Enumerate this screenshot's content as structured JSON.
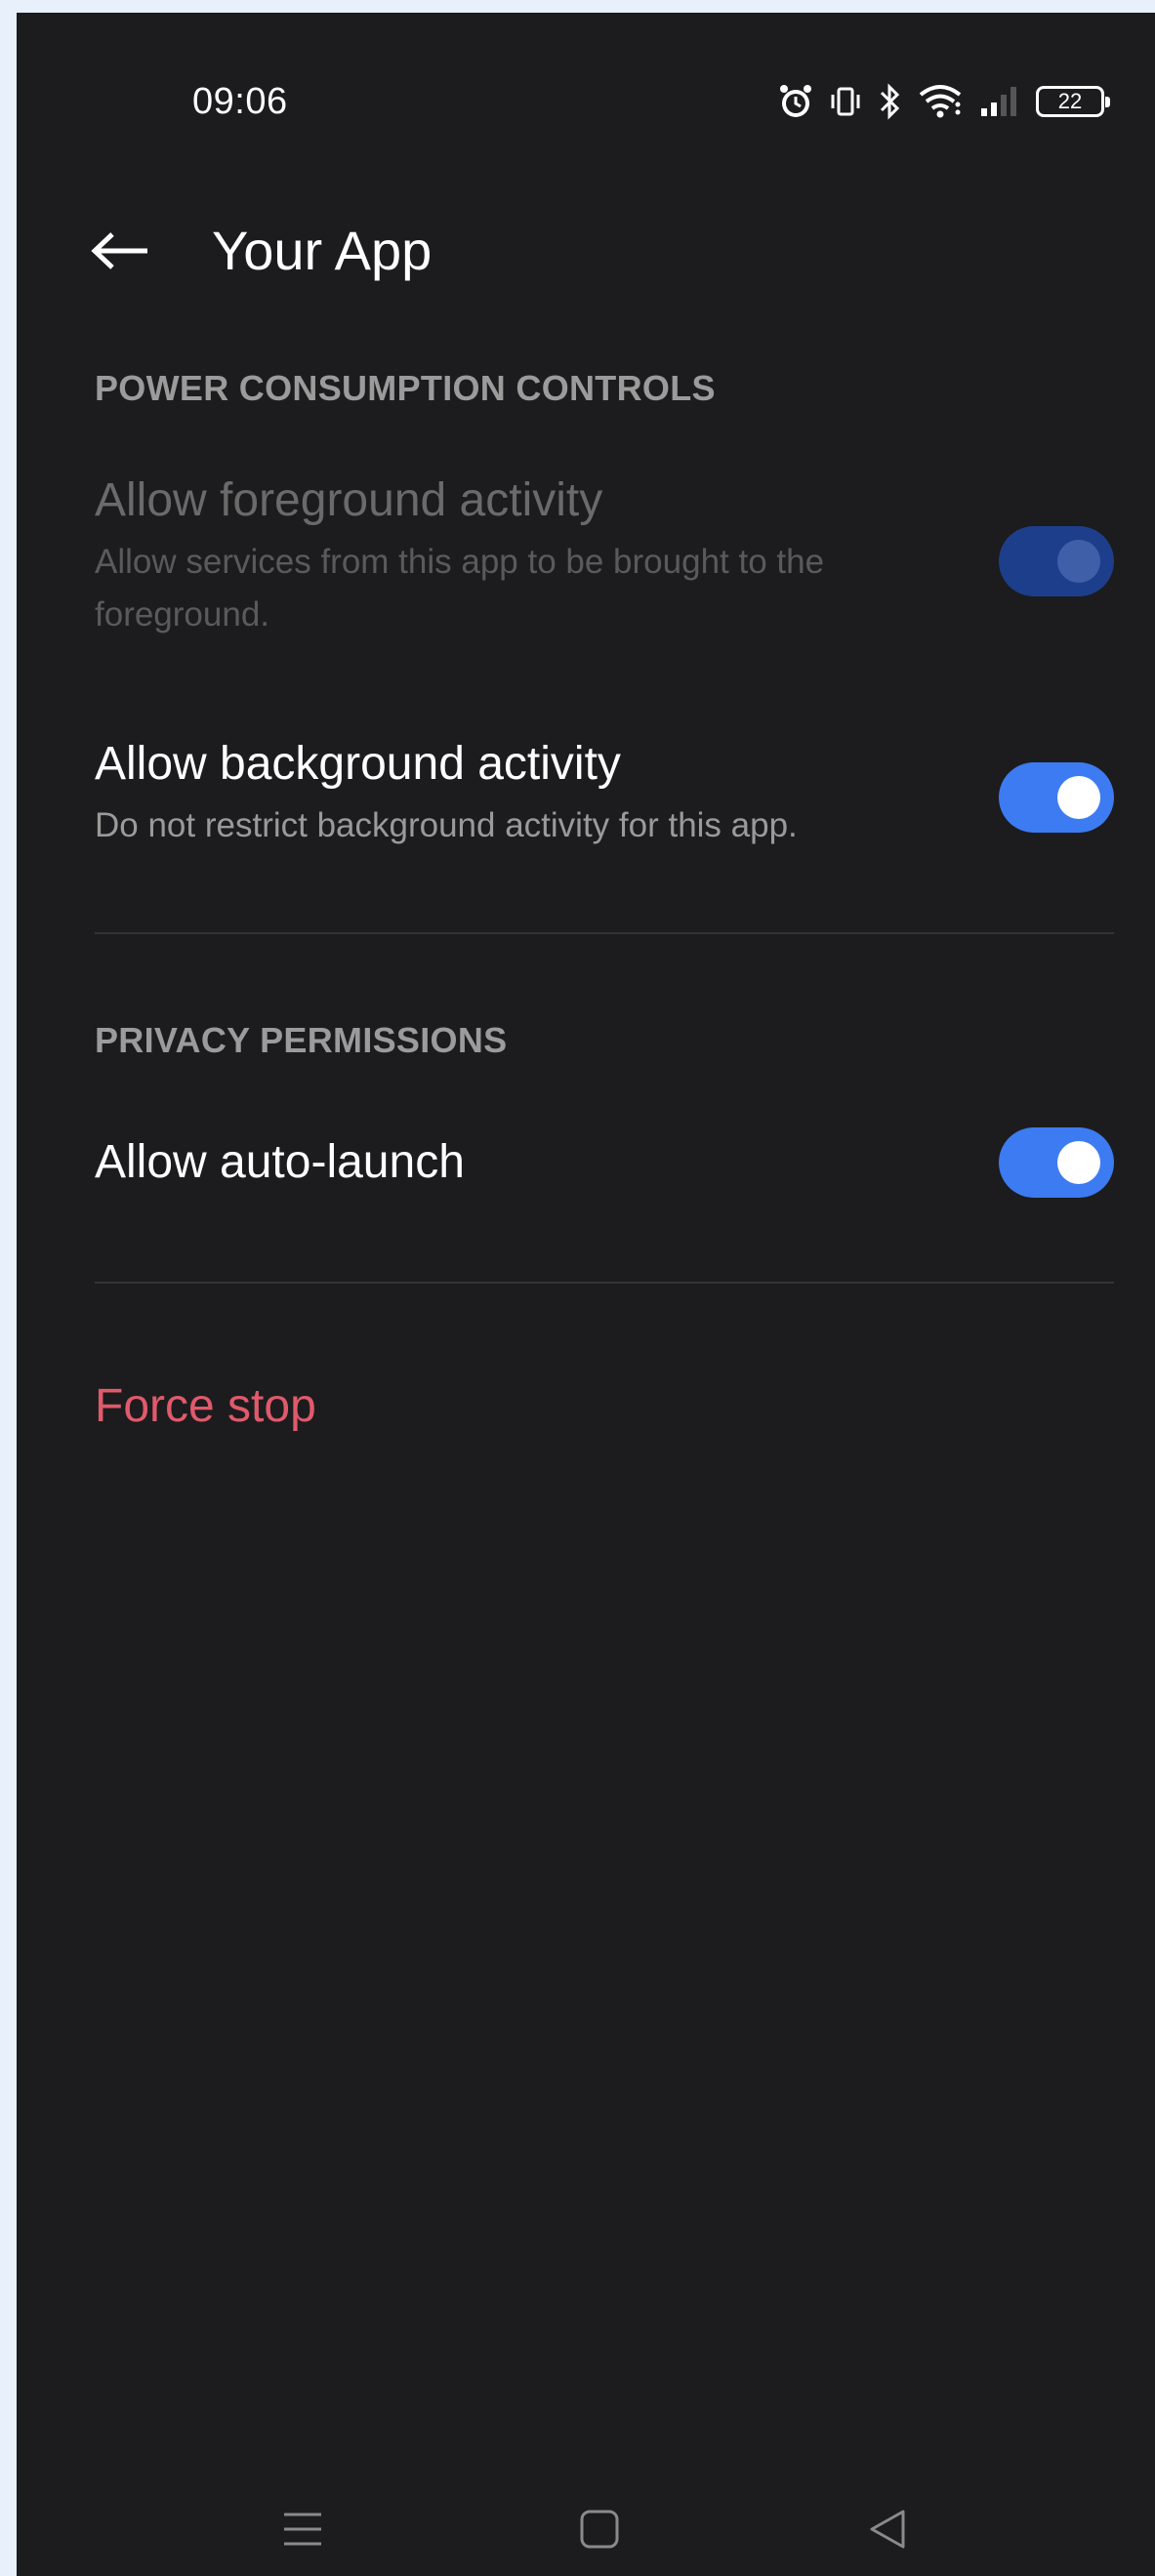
{
  "status_bar": {
    "time": "09:06",
    "battery": "22",
    "icons": [
      "alarm-icon",
      "vibrate-icon",
      "bluetooth-icon",
      "wifi-icon",
      "signal-icon",
      "battery-icon"
    ]
  },
  "header": {
    "back_icon": "arrow-left-icon",
    "title": "Your App"
  },
  "sections": {
    "power": {
      "header": "POWER CONSUMPTION CONTROLS",
      "foreground": {
        "title": "Allow foreground activity",
        "subtitle": "Allow services from this app to be brought to the foreground.",
        "enabled": true,
        "disabled_state": true
      },
      "background": {
        "title": "Allow background activity",
        "subtitle": "Do not restrict background activity for this app.",
        "enabled": true
      }
    },
    "privacy": {
      "header": "PRIVACY PERMISSIONS",
      "auto_launch": {
        "title": "Allow auto-launch",
        "enabled": true
      }
    }
  },
  "actions": {
    "force_stop": "Force stop"
  },
  "nav_bar": {
    "icons": [
      "menu-icon",
      "home-icon",
      "back-icon"
    ]
  },
  "colors": {
    "background": "#1c1c1e",
    "accent": "#3d7bf2",
    "danger": "#e05a6c"
  }
}
